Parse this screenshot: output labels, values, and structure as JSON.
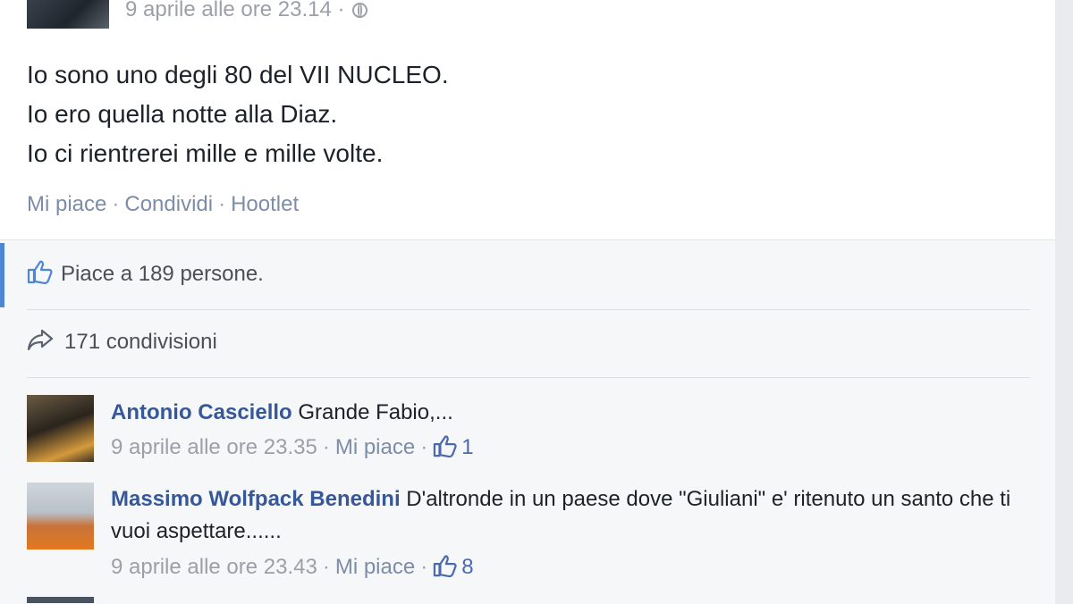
{
  "post": {
    "timestamp": "9 aprile alle ore 23.14",
    "timestamp_separator": "·",
    "globe_icon": "globe-icon",
    "text_lines": [
      "Io sono uno degli 80 del VII NUCLEO.",
      "Io ero quella notte alla Diaz.",
      "Io ci rientrerei mille e mille volte."
    ],
    "actions": {
      "like": "Mi piace",
      "share": "Condividi",
      "hootlet": "Hootlet",
      "separator": "·"
    }
  },
  "feedback": {
    "likes_prefix": "Piace a",
    "likes_count": "189",
    "likes_suffix": "persone.",
    "shares_text": "171 condivisioni",
    "accent_color": "#4e86d6"
  },
  "comments": [
    {
      "author": "Antonio Casciello",
      "text": "Grande Fabio,...",
      "timestamp": "9 aprile alle ore 23.35",
      "like_label": "Mi piace",
      "reactions": "1"
    },
    {
      "author": "Massimo Wolfpack Benedini",
      "text": "D'altronde in un paese dove \"Giuliani\" e' ritenuto un santo che ti vuoi aspettare......",
      "timestamp": "9 aprile alle ore 23.43",
      "like_label": "Mi piace",
      "reactions": "8"
    }
  ],
  "colors": {
    "link_blue": "#365899",
    "muted_gray": "#9ba0a8",
    "background": "#e9ebee"
  }
}
